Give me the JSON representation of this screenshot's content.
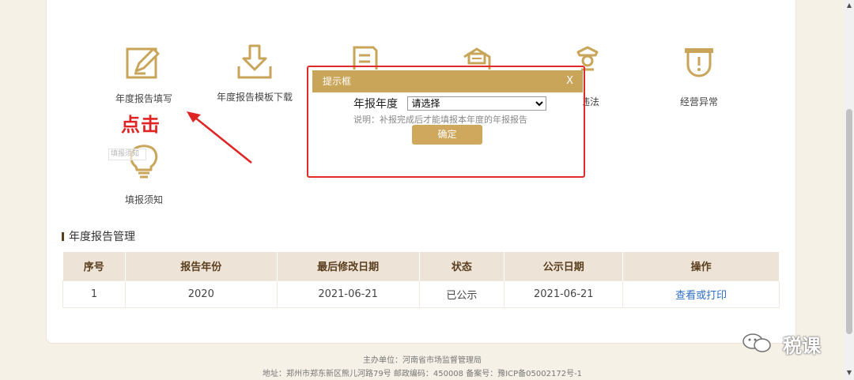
{
  "tiles": [
    {
      "label": "年度报告填写",
      "icon": "edit-form-icon"
    },
    {
      "label": "年度报告模板下载",
      "icon": "download-icon"
    },
    {
      "label": "",
      "icon": "document-icon"
    },
    {
      "label": "",
      "icon": "mail-icon"
    },
    {
      "label": "违法",
      "icon": "officer-icon"
    },
    {
      "label": "经营异常",
      "icon": "shield-alert-icon"
    },
    {
      "label": "填报须知",
      "icon": "lightbulb-icon"
    }
  ],
  "annotation": {
    "click_text": "点击",
    "stamp_text": "填报须知"
  },
  "section_title": "年度报告管理",
  "table": {
    "headers": [
      "序号",
      "报告年份",
      "最后修改日期",
      "状态",
      "公示日期",
      "操作"
    ],
    "rows": [
      [
        "1",
        "2020",
        "2021-06-21",
        "已公示",
        "2021-06-21",
        "查看或打印"
      ]
    ]
  },
  "dialog": {
    "title": "提示框",
    "close": "X",
    "year_label": "年报年度",
    "select_value": "请选择",
    "note": "说明：补报完成后才能填报本年度的年报报告",
    "confirm": "确定"
  },
  "footer": {
    "line1": "主办单位：河南省市场监督管理局",
    "line2": "地址：郑州市郑东新区熊儿河路79号 邮政编码：450008 备案号：豫ICP备05002172号-1"
  },
  "watermark": "税课",
  "colors": {
    "accent": "#c9a55a",
    "highlight": "#e02424",
    "link": "#2f6fc4"
  }
}
